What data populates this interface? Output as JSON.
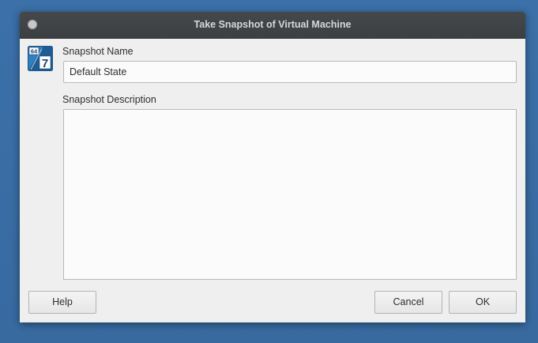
{
  "window": {
    "title": "Take Snapshot of Virtual Machine"
  },
  "icon": {
    "badge_text": "64",
    "glyph": "7"
  },
  "snapshot_name": {
    "label": "Snapshot Name",
    "value": "Default State"
  },
  "snapshot_description": {
    "label": "Snapshot Description",
    "value": ""
  },
  "buttons": {
    "help": "Help",
    "cancel": "Cancel",
    "ok": "OK"
  },
  "colors": {
    "desktop": "#3a6ea5",
    "titlebar": "#424548",
    "dialog_bg": "#efefef",
    "icon_blue": "#2f7fc1"
  }
}
